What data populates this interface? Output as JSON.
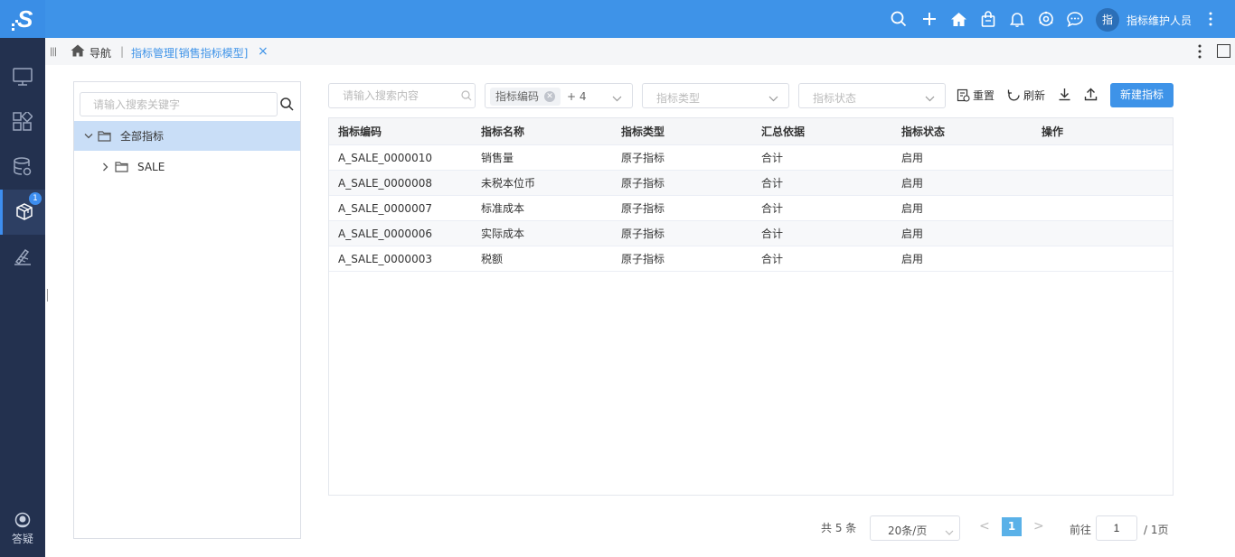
{
  "topbar": {
    "user_avatar": "指",
    "user_name": "指标维护人员"
  },
  "rail": {
    "badge_count": "1",
    "help_label": "答疑"
  },
  "tabs": {
    "nav_label": "导航",
    "separator": "|",
    "active_tab": "指标管理[销售指标模型]",
    "close": "×"
  },
  "tree": {
    "search_placeholder": "请输入搜索关键字",
    "root": "全部指标",
    "children": [
      "SALE"
    ]
  },
  "filters": {
    "keyword_placeholder": "请输入搜索内容",
    "code_tag": "指标编码",
    "code_more": "+ 4",
    "type_placeholder": "指标类型",
    "status_placeholder": "指标状态"
  },
  "toolbar": {
    "reset": "重置",
    "refresh": "刷新",
    "new": "新建指标"
  },
  "table": {
    "columns": [
      "指标编码",
      "指标名称",
      "指标类型",
      "汇总依据",
      "指标状态",
      "操作"
    ],
    "rows": [
      [
        "A_SALE_0000010",
        "销售量",
        "原子指标",
        "合计",
        "启用",
        ""
      ],
      [
        "A_SALE_0000008",
        "未税本位币",
        "原子指标",
        "合计",
        "启用",
        ""
      ],
      [
        "A_SALE_0000007",
        "标准成本",
        "原子指标",
        "合计",
        "启用",
        ""
      ],
      [
        "A_SALE_0000006",
        "实际成本",
        "原子指标",
        "合计",
        "启用",
        ""
      ],
      [
        "A_SALE_0000003",
        "税额",
        "原子指标",
        "合计",
        "启用",
        ""
      ]
    ]
  },
  "pagination": {
    "total": "共 5 条",
    "page_size": "20条/页",
    "prev": "<",
    "current": "1",
    "next": ">",
    "goto": "前往",
    "goto_value": "1",
    "pages": "/ 1页"
  },
  "colors": {
    "accent": "#3e93e8",
    "rail": "#23314f",
    "selected_node": "#c9def7"
  }
}
